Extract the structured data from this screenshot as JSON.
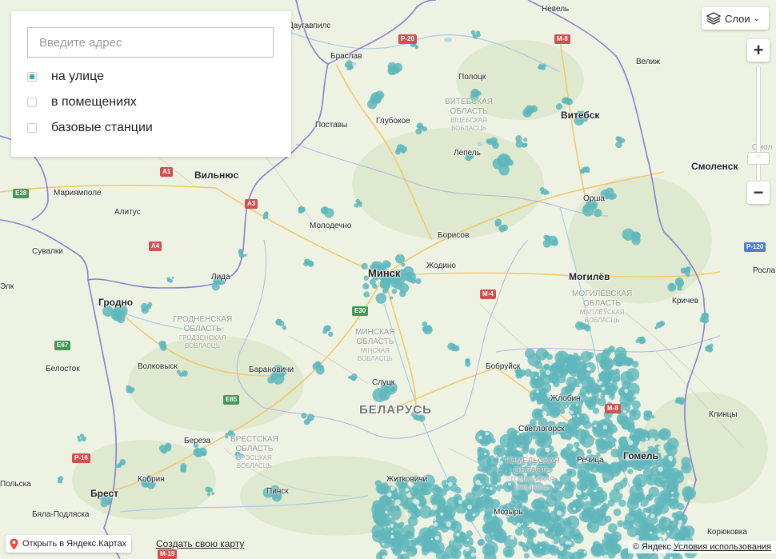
{
  "panel": {
    "address_placeholder": "Введите адрес",
    "options": [
      {
        "label": "на улице",
        "checked": true
      },
      {
        "label": "в помещениях",
        "checked": false
      },
      {
        "label": "базовые станции",
        "checked": false
      }
    ]
  },
  "controls": {
    "layers_label": "Слои",
    "zoom_in": "+",
    "zoom_out": "−"
  },
  "footer": {
    "open_in_yandex": "Открыть в Яндекс.Картах",
    "create_map": "Создать свою карту",
    "copyright": "© Яндекс",
    "terms": "Условия использования"
  },
  "map": {
    "country": "БЕЛАРУСЬ",
    "capital": "Минск",
    "cities_big": [
      "Вильнюс",
      "Витебск",
      "Гродно",
      "Гомель",
      "Могилёв",
      "Смоленск",
      "Брест"
    ],
    "cities": [
      "Невель",
      "Даугавпилс",
      "Браслав",
      "Полоцк",
      "Велиж",
      "Глубокое",
      "Поставы",
      "Лепель",
      "Мариямполе",
      "Алитус",
      "Молодечно",
      "Борисов",
      "Орша",
      "Сувалки",
      "Лида",
      "Жодино",
      "Элк",
      "Кричев",
      "Белосток",
      "Волковыск",
      "Барановичи",
      "Слуцк",
      "Бобруйск",
      "Жлобин",
      "Светлогорск",
      "Речица",
      "Клинцы",
      "Береза",
      "Кобрин",
      "Пинск",
      "Житковичи",
      "Мозырь",
      "Бяла-Подляска",
      "Корюковка",
      "Польска",
      "Росла",
      "Смол"
    ],
    "regions": [
      {
        "name1": "ВИТЕБСКАЯ",
        "name2": "ОБЛАСТЬ",
        "sub1": "ВІЦЕБСКАЯ",
        "sub2": "ВОБЛАСЦЬ"
      },
      {
        "name1": "ГРОДНЕНСКАЯ",
        "name2": "ОБЛАСТЬ",
        "sub1": "ГРОДЗЕНСКАЯ",
        "sub2": "ВОБЛАСЦЬ"
      },
      {
        "name1": "МИНСКАЯ",
        "name2": "ОБЛАСТЬ",
        "sub1": "МІНСКАЯ",
        "sub2": "ВОБЛАСЦЬ"
      },
      {
        "name1": "МОГИЛЁВСКАЯ",
        "name2": "ОБЛАСТЬ",
        "sub1": "МАГІЛЁЎСКАЯ",
        "sub2": "ВОБЛАСЦЬ"
      },
      {
        "name1": "БРЕСТСКАЯ",
        "name2": "ОБЛАСТЬ",
        "sub1": "БРЭСЦКАЯ",
        "sub2": "ВОБЛАСЦЬ"
      },
      {
        "name1": "ГОМЕЛЬСКАЯ",
        "name2": "ОБЛАСТЬ",
        "sub1": "ГОМЕЛЬСКАЯ",
        "sub2": "ВОБЛАСЦЬ"
      }
    ],
    "roads": [
      "P-20",
      "M-8",
      "A1",
      "E28",
      "A3",
      "A4",
      "E67",
      "E30",
      "M-4",
      "E85",
      "P-16",
      "M-19",
      "P-120",
      "M-8"
    ],
    "colors": {
      "coverage": "#5fb7bc",
      "border": "#8a7fd0",
      "background": "#eef2e3",
      "accent": "#2eb3ac"
    }
  }
}
